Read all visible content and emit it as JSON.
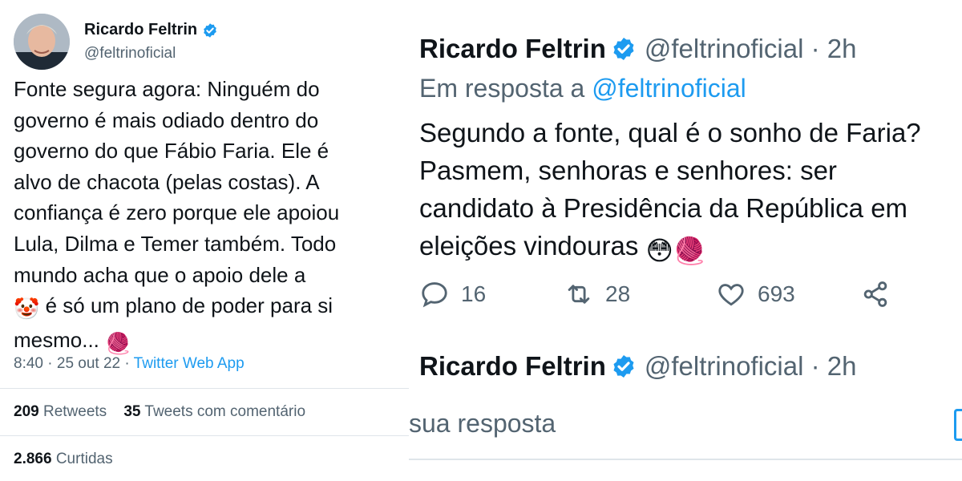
{
  "colors": {
    "accent": "#1d9bf0",
    "text": "#0f1419",
    "muted": "#536471",
    "divider": "#dfe5ea"
  },
  "left_tweet": {
    "author": {
      "name": "Ricardo Feltrin",
      "handle": "@feltrinoficial",
      "avatar_icon": "avatar-photo",
      "verified_icon": "verified-badge-icon"
    },
    "text_lines": [
      "Fonte segura agora: Ninguém do",
      "governo é mais odiado dentro do",
      "governo do que Fábio Faria. Ele é",
      "alvo de chacota (pelas costas). A",
      "confiança é zero porque ele apoiou",
      "Lula, Dilma e Temer também. Todo",
      "mundo acha que o apoio dele a",
      "é só um plano de poder para si",
      "mesmo..."
    ],
    "emojis": {
      "clown": "🤡",
      "yarn": "🧶"
    },
    "meta": {
      "time": "8:40",
      "date": "25 out 22",
      "separator": " · ",
      "app": "Twitter Web App"
    },
    "stats": {
      "retweets_count": "209",
      "retweets_label": "Retweets",
      "quotes_count": "35",
      "quotes_label": "Tweets com comentário",
      "likes_count": "2.866",
      "likes_label": "Curtidas"
    }
  },
  "right_thread": {
    "tweet": {
      "name": "Ricardo Feltrin",
      "handle_time": "@feltrinoficial · 2h",
      "reply_prefix": "Em resposta a ",
      "reply_mention": "@feltrinoficial",
      "text_lines": [
        "Segundo a fonte, qual é o sonho de Faria?",
        "Pasmem, senhoras e senhores: ser",
        "candidato à Presidência da República em",
        "eleições vindouras"
      ],
      "emojis": {
        "flushed": "😳",
        "yarn": "🧶"
      },
      "actions": {
        "replies": "16",
        "retweets": "28",
        "likes": "693"
      }
    },
    "next_tweet": {
      "name": "Ricardo Feltrin",
      "handle_time": "@feltrinoficial · 2h"
    },
    "composer_placeholder": "sua resposta"
  }
}
